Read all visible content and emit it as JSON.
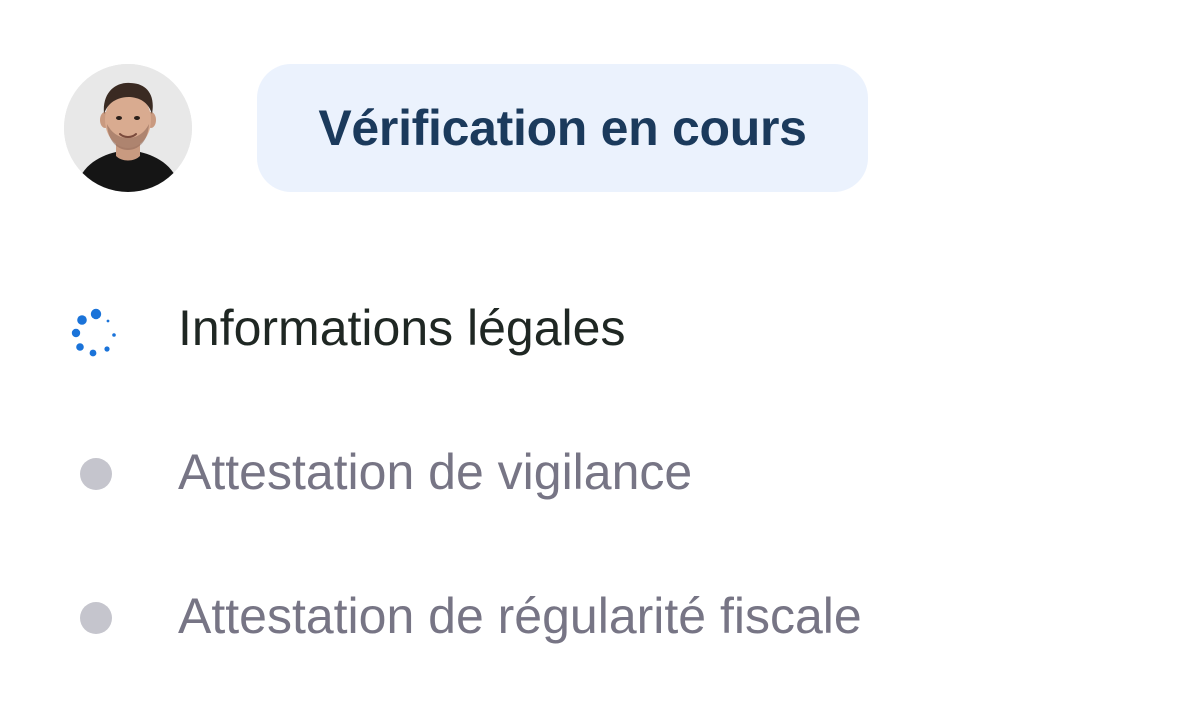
{
  "status": {
    "label": "Vérification en cours"
  },
  "steps": [
    {
      "label": "Informations légales",
      "state": "in-progress"
    },
    {
      "label": "Attestation de vigilance",
      "state": "pending"
    },
    {
      "label": "Attestation de régularité fiscale",
      "state": "pending"
    }
  ],
  "colors": {
    "pill_background": "#ebf2fd",
    "pill_text": "#1b3a5c",
    "active_text": "#1f2723",
    "pending_text": "#777585",
    "spinner": "#1a73d9",
    "pending_dot": "#c5c5cd"
  }
}
